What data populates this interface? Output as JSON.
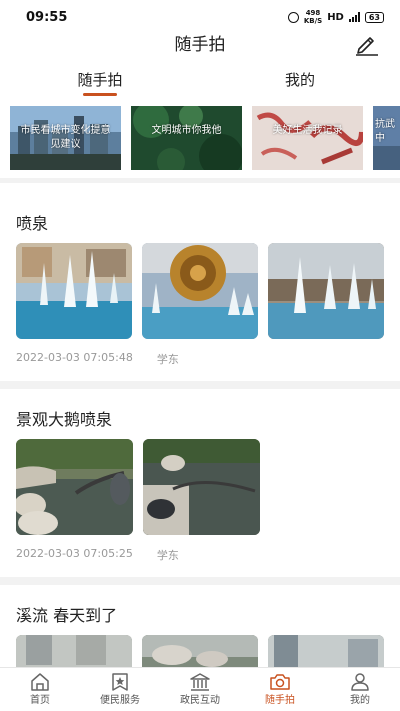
{
  "status_bar": {
    "time": "09:55",
    "speed": "498",
    "speed_unit": "KB/S",
    "hd": "HD",
    "battery": "63"
  },
  "header": {
    "title": "随手拍",
    "edit_icon": "edit-icon"
  },
  "tabs": [
    {
      "label": "随手拍",
      "active": true
    },
    {
      "label": "我的",
      "active": false
    }
  ],
  "topics": [
    {
      "label": "市民看城市变化提意见建议"
    },
    {
      "label": "文明城市你我他"
    },
    {
      "label": "美好生活我记录"
    },
    {
      "label": "抗武中"
    }
  ],
  "posts": [
    {
      "title": "喷泉",
      "date": "2022-03-03 07:05:48",
      "author": "学东"
    },
    {
      "title": "景观大鹅喷泉",
      "date": "2022-03-03 07:05:25",
      "author": "学东"
    },
    {
      "title": "溪流  春天到了"
    }
  ],
  "bottom_nav": [
    {
      "label": "首页",
      "icon": "home-icon"
    },
    {
      "label": "便民服务",
      "icon": "bookmark-star-icon"
    },
    {
      "label": "政民互动",
      "icon": "government-building-icon"
    },
    {
      "label": "随手拍",
      "icon": "camera-icon",
      "active": true
    },
    {
      "label": "我的",
      "icon": "user-icon"
    }
  ],
  "colors": {
    "accent": "#c9511f",
    "background": "#f2f2f2"
  }
}
